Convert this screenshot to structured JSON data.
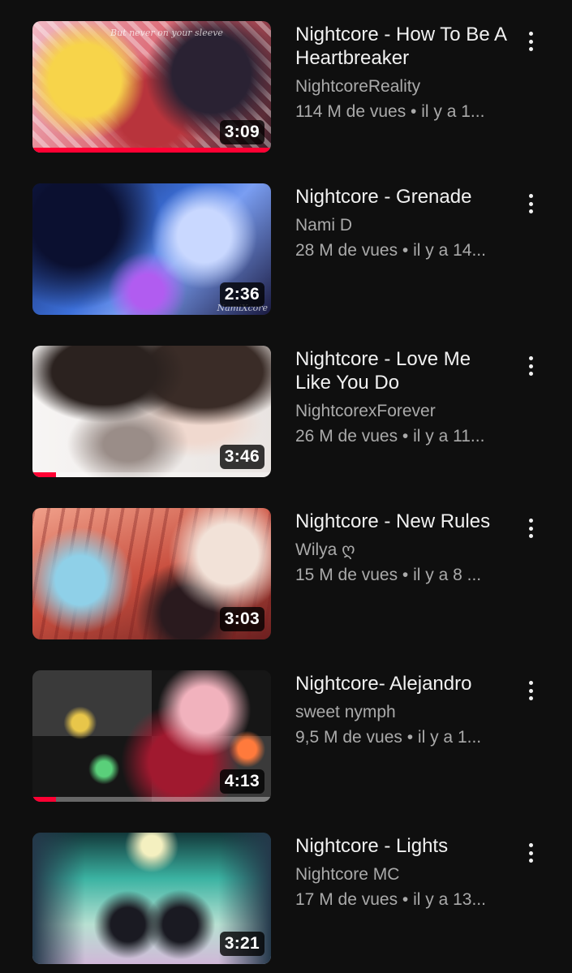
{
  "videos": [
    {
      "title": "Nightcore - How To Be A Heartbreaker",
      "channel": "NightcoreReality",
      "stats": "114 M de vues • il y a 1...",
      "duration": "3:09",
      "progress": 1.0,
      "thumb_text": "But never on your sleeve",
      "thumb_colors": [
        "#f3c7cf",
        "#c9474f",
        "#2a1a22"
      ]
    },
    {
      "title": "Nightcore - Grenade",
      "channel": "Nami D",
      "stats": "28 M de vues • il y a 14...",
      "duration": "2:36",
      "progress": 0,
      "thumb_text": "NamiXcore",
      "thumb_colors": [
        "#1a2a6a",
        "#4c7de0",
        "#8a3bd1"
      ]
    },
    {
      "title": "Nightcore - Love Me Like You Do",
      "channel": "NightcorexForever",
      "stats": "26 M de vues • il y a 11...",
      "duration": "3:46",
      "progress": 0.1,
      "thumb_text": "",
      "thumb_colors": [
        "#f5f3f2",
        "#3a2e2a",
        "#c9b5aa"
      ]
    },
    {
      "title": "Nightcore - New Rules",
      "channel": "Wilya ღ",
      "stats": "15 M de vues • il y a 8 ...",
      "duration": "3:03",
      "progress": 0,
      "thumb_text": "",
      "thumb_colors": [
        "#e58a76",
        "#7a2f2b",
        "#f1d1c2"
      ]
    },
    {
      "title": "Nightcore- Alejandro",
      "channel": "sweet nymph",
      "stats": "9,5 M de vues • il y a 1...",
      "duration": "4:13",
      "progress": 0.1,
      "thumb_text": "",
      "thumb_colors": [
        "#101010",
        "#8c1730",
        "#e35c7a"
      ]
    },
    {
      "title": "Nightcore - Lights",
      "channel": "Nightcore MC",
      "stats": "17 M de vues • il y a 13...",
      "duration": "3:21",
      "progress": 0,
      "thumb_text": "",
      "thumb_colors": [
        "#1b3b3a",
        "#4fc7b8",
        "#c9a0d8"
      ]
    }
  ]
}
